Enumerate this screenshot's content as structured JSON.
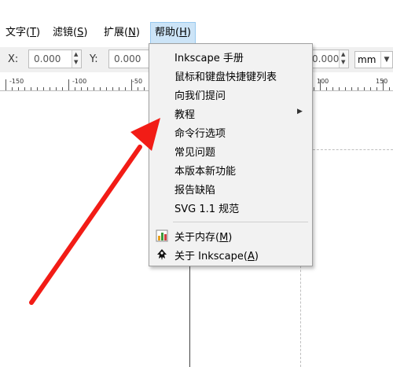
{
  "menubar": {
    "text": {
      "label": "文字(",
      "key": "T",
      "end": ")"
    },
    "filter": {
      "label": "滤镜(",
      "key": "S",
      "end": ")"
    },
    "extensions": {
      "label": "扩展(",
      "key": "N",
      "end": ")"
    },
    "help": {
      "label": "帮助(",
      "key": "H",
      "end": ")"
    }
  },
  "toolbar": {
    "x_label": "X:",
    "x_value": "0.000",
    "y_label": "Y:",
    "y_value": "0.000",
    "h_value": "0.000",
    "unit": "mm"
  },
  "ruler": {
    "labels": [
      "-150",
      "-100",
      "-50",
      "100",
      "150"
    ]
  },
  "help_menu": {
    "items": [
      {
        "label": "Inkscape 手册"
      },
      {
        "label": "鼠标和键盘快捷键列表"
      },
      {
        "label": "向我们提问"
      },
      {
        "label": "教程"
      },
      {
        "label": "命令行选项"
      },
      {
        "label": "常见问题"
      },
      {
        "label": "本版本新功能"
      },
      {
        "label": "报告缺陷"
      },
      {
        "label": "SVG 1.1 规范"
      }
    ],
    "about_memory": {
      "label": "关于内存(",
      "key": "M",
      "end": ")"
    },
    "about_inkscape": {
      "label": "关于 Inkscape(",
      "key": "A",
      "end": ")"
    }
  },
  "colors": {
    "menu_highlight": "#cce4f7",
    "annotation_arrow": "#f21c16"
  }
}
